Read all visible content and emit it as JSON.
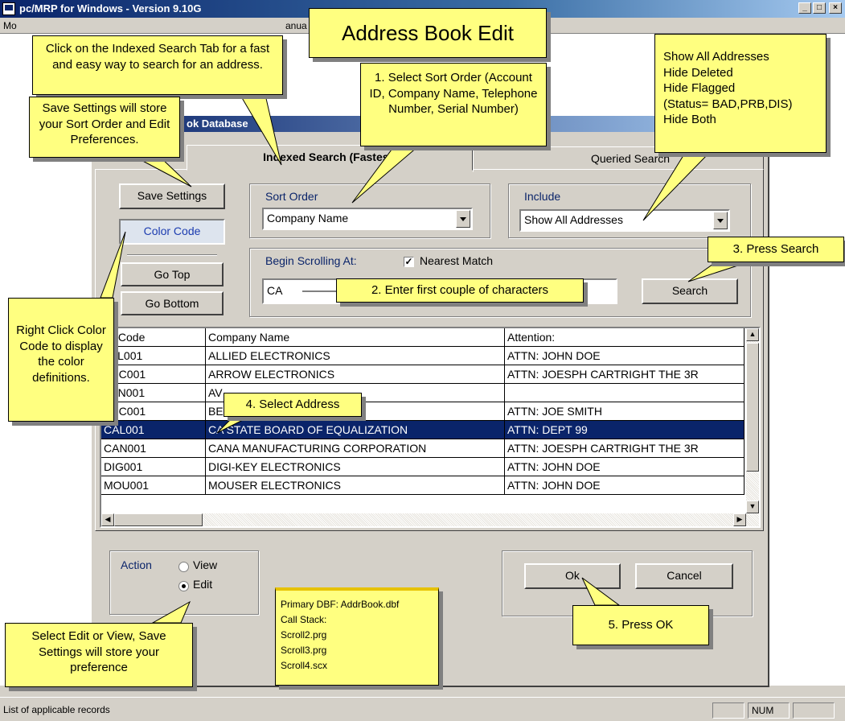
{
  "window": {
    "title": "pc/MRP for Windows - Version 9.10G",
    "controls": [
      "_",
      "□",
      "×"
    ],
    "menu_left": "Mo",
    "menu_right": "anua"
  },
  "dialog": {
    "title_fragment": "ok Database"
  },
  "tabs": {
    "indexed": "Indexed Search (Fastest)",
    "queried": "Queried Search"
  },
  "left_buttons": {
    "save": "Save Settings",
    "color": "Color Code",
    "top": "Go Top",
    "bottom": "Go Bottom"
  },
  "sort_order": {
    "label": "Sort Order",
    "value": "Company Name"
  },
  "include": {
    "label": "Include",
    "value": "Show All Addresses"
  },
  "scroll": {
    "label": "Begin Scrolling At:",
    "nearest": "Nearest Match",
    "nearest_checked": true,
    "value": "CA"
  },
  "search_button": "Search",
  "grid": {
    "headers": [
      "ID Code",
      "Company Name",
      "Attention:"
    ],
    "rows": [
      [
        "ALL001",
        "ALLIED ELECTRONICS",
        "ATTN: JOHN DOE"
      ],
      [
        "ABC001",
        "ARROW ELECTRONICS",
        "ATTN: JOESPH CARTRIGHT THE 3R"
      ],
      [
        "AVN001",
        "AV",
        ""
      ],
      [
        "BBC001",
        "BE                          OMPANY",
        "ATTN: JOE SMITH"
      ],
      [
        "CAL001",
        "CA STATE BOARD OF EQUALIZATION",
        "ATTN: DEPT 99"
      ],
      [
        "CAN001",
        "CANA MANUFACTURING CORPORATION",
        "ATTN: JOESPH CARTRIGHT THE 3R"
      ],
      [
        "DIG001",
        "DIGI-KEY ELECTRONICS",
        "ATTN: JOHN DOE"
      ],
      [
        "MOU001",
        "MOUSER ELECTRONICS",
        "ATTN: JOHN DOE"
      ]
    ],
    "selected_index": 4
  },
  "action": {
    "label": "Action",
    "view": "View",
    "edit": "Edit",
    "selected": "edit"
  },
  "ok_button": "Ok",
  "cancel_button": "Cancel",
  "status": {
    "text": "List of applicable records",
    "num": "NUM"
  },
  "callouts": {
    "heading": "Address Book Edit",
    "indexed_tip": "Click on the Indexed Search Tab for a fast and easy way to search for an address.",
    "save_tip": "Save Settings will store your Sort Order and Edit Preferences.",
    "sort_tip": "1. Select Sort Order (Account ID, Company Name, Telephone Number, Serial Number)",
    "include_tip": [
      "Show All Addresses",
      "Hide Deleted",
      "Hide Flagged",
      "(Status= BAD,PRB,DIS)",
      "Hide Both"
    ],
    "press_search": "3. Press Search",
    "enter_chars": "2. Enter first couple of characters",
    "color_tip": "Right Click Color Code to display the color definitions.",
    "select_address": "4. Select Address",
    "edit_view_tip": "Select Edit or View, Save Settings will store your preference",
    "press_ok": "5. Press OK",
    "stack_lines": [
      "Primary DBF: AddrBook.dbf",
      "Call Stack:",
      "Scroll2.prg",
      "Scroll3.prg",
      "Scroll4.scx"
    ]
  },
  "colors": {
    "title_blue": "#0a246a",
    "callout_yellow": "#ffff80",
    "face": "#d4d0c8"
  }
}
